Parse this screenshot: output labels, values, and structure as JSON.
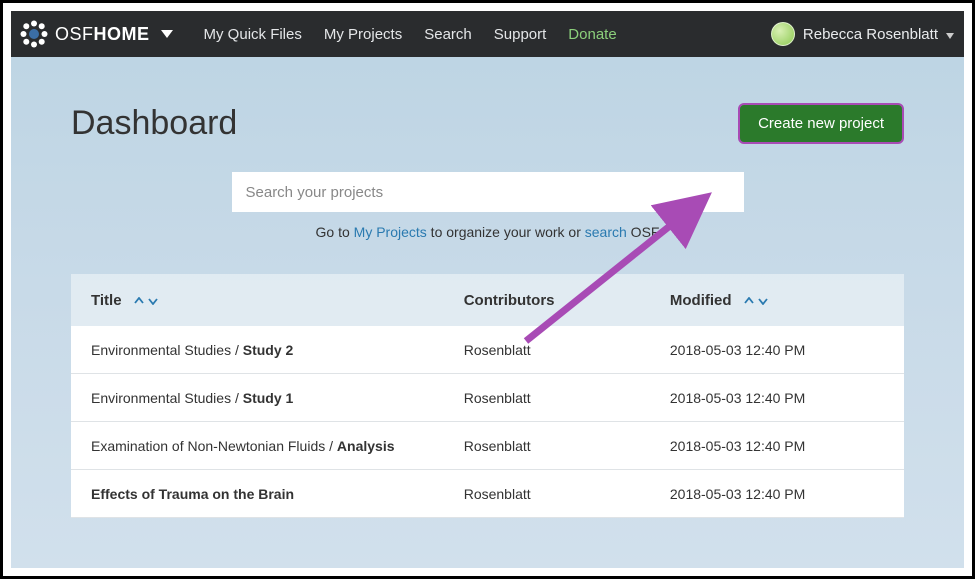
{
  "nav": {
    "brand_light": "OSF",
    "brand_bold": "HOME",
    "links": {
      "quick_files": "My Quick Files",
      "my_projects": "My Projects",
      "search": "Search",
      "support": "Support",
      "donate": "Donate"
    },
    "user_name": "Rebecca Rosenblatt"
  },
  "dashboard": {
    "title": "Dashboard",
    "create_button": "Create new project",
    "search_placeholder": "Search your projects",
    "helper_prefix": "Go to ",
    "helper_link1": "My Projects",
    "helper_mid": " to organize your work or ",
    "helper_link2": "search",
    "helper_suffix": " OSF"
  },
  "table": {
    "headers": {
      "title": "Title",
      "contributors": "Contributors",
      "modified": "Modified"
    },
    "rows": [
      {
        "title_prefix": "Environmental Studies / ",
        "title_bold": "Study 2",
        "contributors": "Rosenblatt",
        "modified": "2018-05-03 12:40 PM",
        "all_bold": false
      },
      {
        "title_prefix": "Environmental Studies / ",
        "title_bold": "Study 1",
        "contributors": "Rosenblatt",
        "modified": "2018-05-03 12:40 PM",
        "all_bold": false
      },
      {
        "title_prefix": "Examination of Non-Newtonian Fluids / ",
        "title_bold": "Analysis",
        "contributors": "Rosenblatt",
        "modified": "2018-05-03 12:40 PM",
        "all_bold": false
      },
      {
        "title_prefix": "",
        "title_bold": "Effects of Trauma on the Brain",
        "contributors": "Rosenblatt",
        "modified": "2018-05-03 12:40 PM",
        "all_bold": true
      }
    ]
  },
  "colors": {
    "navbar_bg": "#2a2c2e",
    "accent_green": "#2b7a2b",
    "annotation_purple": "#a84bb5",
    "link_blue": "#2a7ab0"
  }
}
